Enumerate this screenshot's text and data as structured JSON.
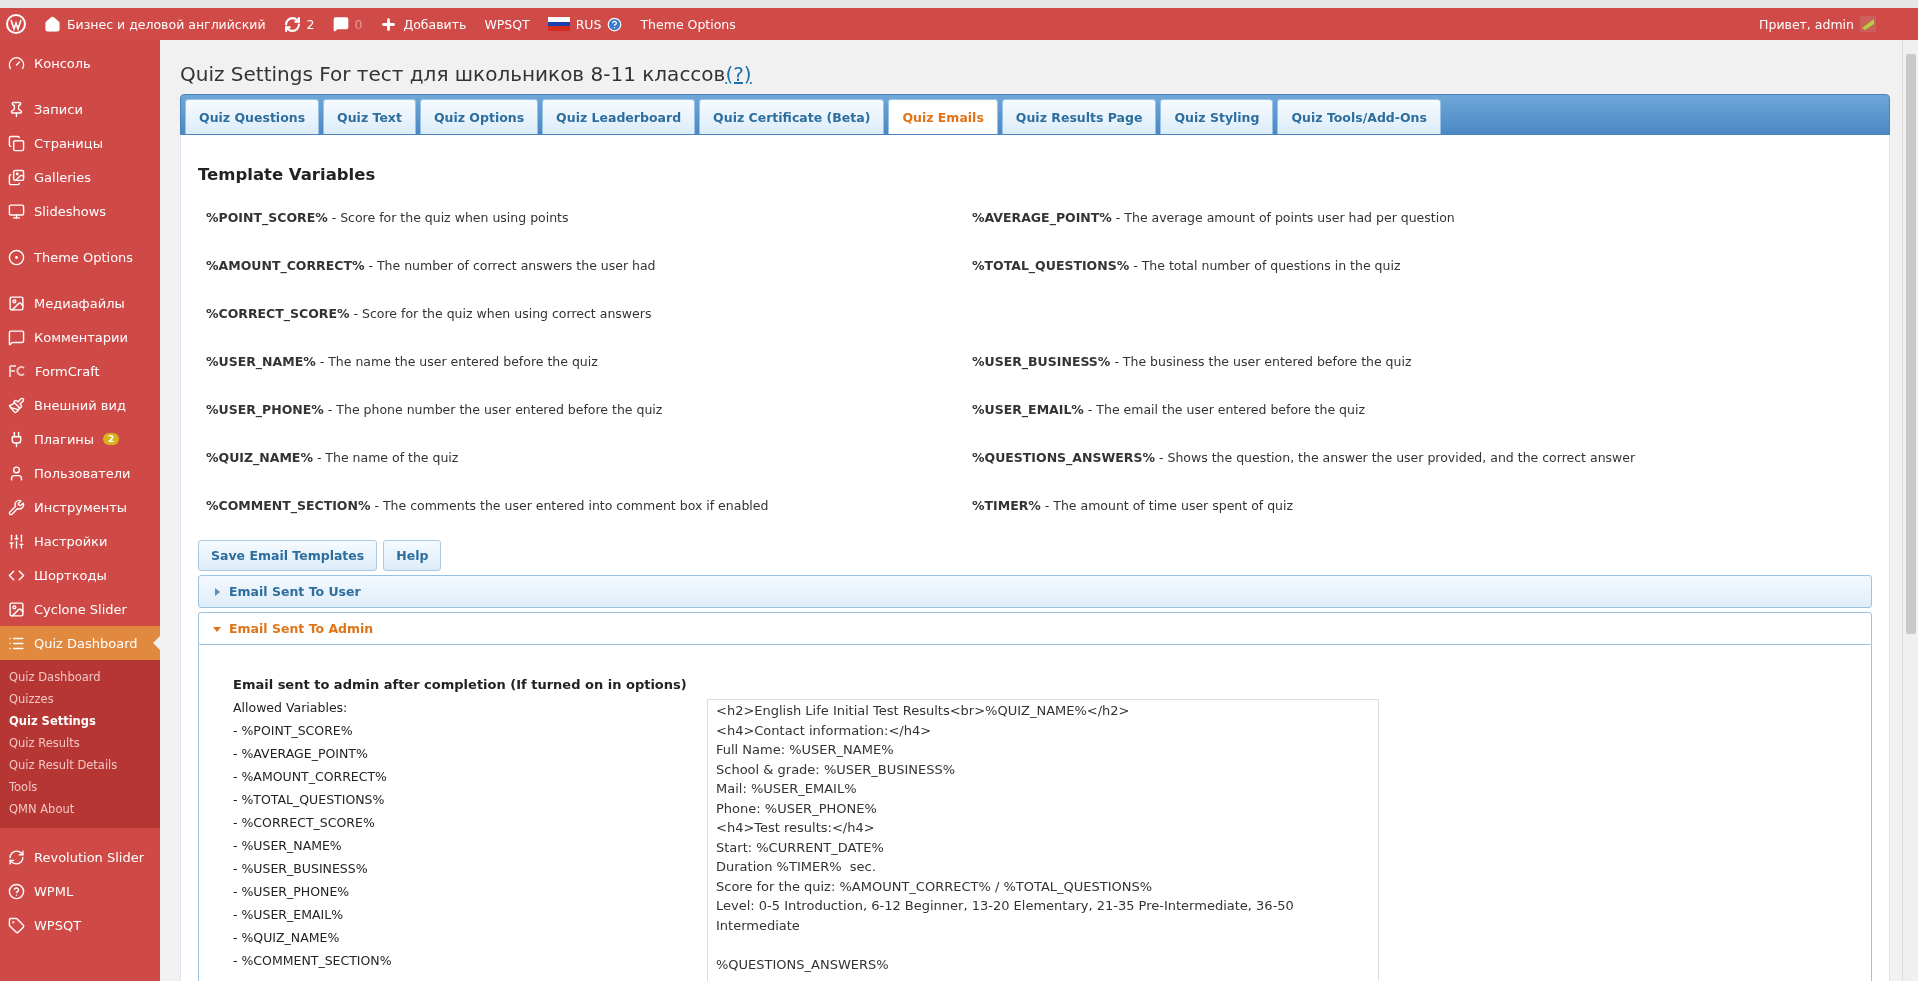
{
  "admin_bar": {
    "items": [
      {
        "kind": "logo"
      },
      {
        "kind": "home",
        "label": "Бизнес и деловой английский"
      },
      {
        "kind": "updates",
        "label": "2"
      },
      {
        "kind": "comments",
        "label": "0"
      },
      {
        "kind": "add",
        "label": "Добавить"
      },
      {
        "kind": "text",
        "label": "WPSQT"
      },
      {
        "kind": "flag",
        "label": "RUS"
      },
      {
        "kind": "text",
        "label": "Theme Options"
      }
    ],
    "greeting": "Привет, admin"
  },
  "sidebar": {
    "groups": [
      [
        {
          "label": "Консоль",
          "selected": false
        }
      ],
      [
        {
          "label": "Записи",
          "selected": false
        },
        {
          "label": "Страницы",
          "selected": false
        },
        {
          "label": "Galleries",
          "selected": false
        },
        {
          "label": "Slideshows",
          "selected": false
        }
      ],
      [
        {
          "label": "Theme Options",
          "selected": false
        }
      ],
      [
        {
          "label": "Медиафайлы",
          "selected": false
        },
        {
          "label": "Комментарии",
          "selected": false
        },
        {
          "label": "FormCraft",
          "selected": false
        },
        {
          "label": "Внешний вид",
          "selected": false
        },
        {
          "label": "Плагины",
          "badge": "2",
          "selected": false
        },
        {
          "label": "Пользователи",
          "selected": false
        },
        {
          "label": "Инструменты",
          "selected": false
        },
        {
          "label": "Настройки",
          "selected": false
        },
        {
          "label": "Шорткоды",
          "selected": false
        },
        {
          "label": "Cyclone Slider",
          "selected": false
        },
        {
          "label": "Quiz Dashboard",
          "selected": true,
          "children": [
            {
              "label": "Quiz Dashboard",
              "selected": false
            },
            {
              "label": "Quizzes",
              "selected": false
            },
            {
              "label": "Quiz Settings",
              "selected": true
            },
            {
              "label": "Quiz Results",
              "selected": false
            },
            {
              "label": "Quiz Result Details",
              "selected": false
            },
            {
              "label": "Tools",
              "selected": false
            },
            {
              "label": "QMN About",
              "selected": false
            }
          ]
        }
      ],
      [
        {
          "label": "Revolution Slider",
          "selected": false
        },
        {
          "label": "WPML",
          "selected": false
        },
        {
          "label": "WPSQT",
          "selected": false
        }
      ]
    ]
  },
  "page": {
    "title": "Quiz Settings For тест для школьников 8-11 классов",
    "help_link": "(?)"
  },
  "tabs": [
    {
      "label": "Quiz Questions",
      "selected": false
    },
    {
      "label": "Quiz Text",
      "selected": false
    },
    {
      "label": "Quiz Options",
      "selected": false
    },
    {
      "label": "Quiz Leaderboard",
      "selected": false
    },
    {
      "label": "Quiz Certificate (Beta)",
      "selected": false
    },
    {
      "label": "Quiz Emails",
      "selected": true
    },
    {
      "label": "Quiz Results Page",
      "selected": false
    },
    {
      "label": "Quiz Styling",
      "selected": false
    },
    {
      "label": "Quiz Tools/Add-Ons",
      "selected": false
    }
  ],
  "template_variables": {
    "heading": "Template Variables",
    "rows": [
      {
        "left": "**%POINT_SCORE%** - Score for the quiz when using points",
        "right": "**%AVERAGE_POINT%** - The average amount of points user had per question"
      },
      {
        "left": "**%AMOUNT_CORRECT%** - The number of correct answers the user had",
        "right": "**%TOTAL_QUESTIONS%** - The total number of questions in the quiz"
      },
      {
        "left": "**%CORRECT_SCORE%** - Score for the quiz when using correct answers"
      },
      {
        "left": "**%USER_NAME%** - The name the user entered before the quiz",
        "right": "**%USER_BUSINESS%** - The business the user entered before the quiz"
      },
      {
        "left": "**%USER_PHONE%** - The phone number the user entered before the quiz",
        "right": "**%USER_EMAIL%** - The email the user entered before the quiz"
      },
      {
        "left": "**%QUIZ_NAME%** - The name of the quiz",
        "right": "**%QUESTIONS_ANSWERS%** - Shows the question, the answer the user provided, and the correct answer"
      },
      {
        "left": "**%COMMENT_SECTION%** - The comments the user entered into comment box if enabled",
        "right": "**%TIMER%** - The amount of time user spent of quiz"
      }
    ]
  },
  "buttons": [
    "Save Email Templates",
    "Help"
  ],
  "accordion": [
    {
      "title": "Email Sent To User",
      "expanded": false
    },
    {
      "title": "Email Sent To Admin",
      "expanded": true,
      "heading": "Email sent to admin after completion (If turned on in options)",
      "allowed_label": "Allowed Variables:",
      "variables": [
        "- %POINT_SCORE%",
        "- %AVERAGE_POINT%",
        "- %AMOUNT_CORRECT%",
        "- %TOTAL_QUESTIONS%",
        "- %CORRECT_SCORE%",
        "- %USER_NAME%",
        "- %USER_BUSINESS%",
        "- %USER_PHONE%",
        "- %USER_EMAIL%",
        "- %QUIZ_NAME%",
        "- %COMMENT_SECTION%"
      ],
      "template": "<h2>English Life Initial Test Results<br>%QUIZ_NAME%</h2>\n<h4>Contact information:</h4>\nFull Name: %USER_NAME%\nSchool & grade: %USER_BUSINESS%\nMail: %USER_EMAIL%\nPhone: %USER_PHONE%\n<h4>Test results:</h4>\nStart: %CURRENT_DATE%\nDuration %TIMER%  sec.\nScore for the quiz: %AMOUNT_CORRECT% / %TOTAL_QUESTIONS%\nLevel: 0-5 Introduction, 6-12 Beginner, 13-20 Elementary, 21-35 Pre-Intermediate, 36-50 Intermediate\n\n%QUESTIONS_ANSWERS%"
    }
  ]
}
